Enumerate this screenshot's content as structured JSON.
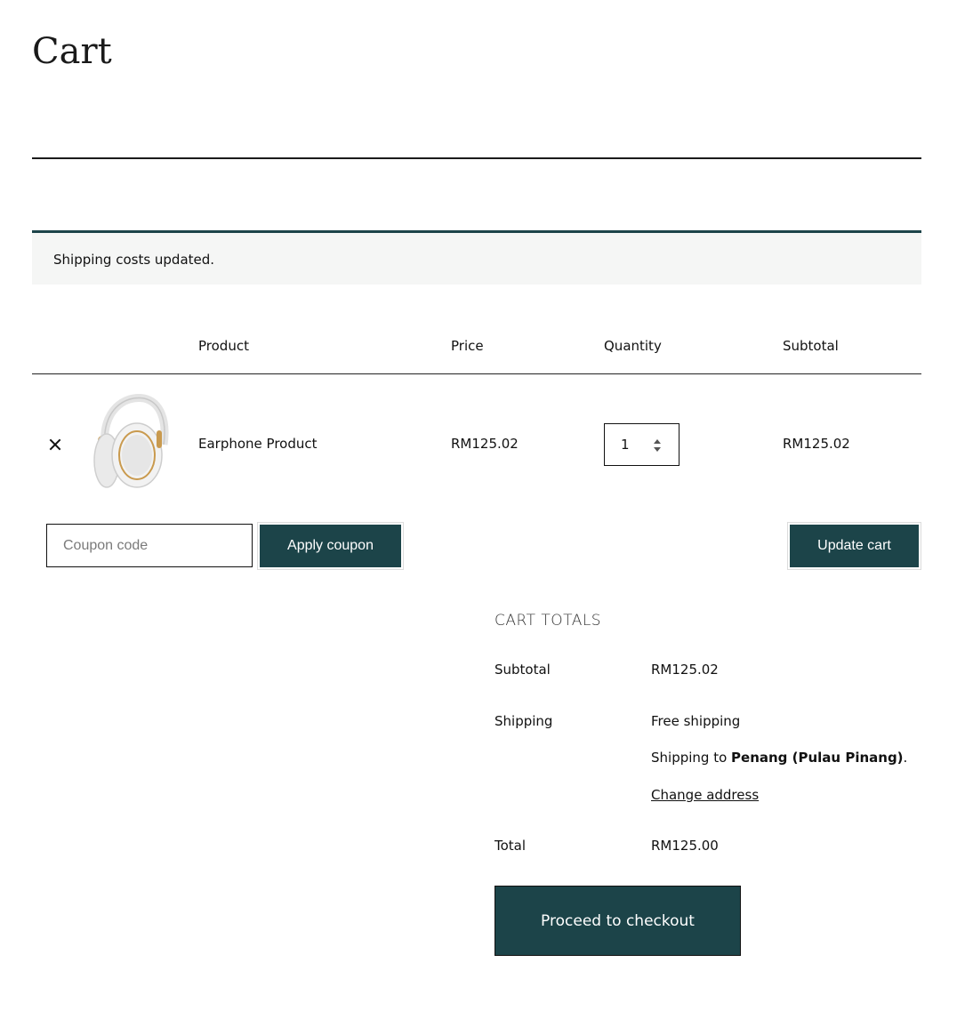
{
  "page": {
    "title": "Cart"
  },
  "notice": {
    "text": "Shipping costs updated."
  },
  "table": {
    "headers": {
      "product": "Product",
      "price": "Price",
      "quantity": "Quantity",
      "subtotal": "Subtotal"
    },
    "rows": [
      {
        "name": "Earphone Product",
        "price": "RM125.02",
        "quantity": "1",
        "subtotal": "RM125.02",
        "thumbnail_icon": "headphones-image"
      }
    ]
  },
  "coupon": {
    "placeholder": "Coupon code",
    "apply_label": "Apply coupon"
  },
  "update_label": "Update cart",
  "totals": {
    "heading": "CART TOTALS",
    "subtotal_label": "Subtotal",
    "subtotal_value": "RM125.02",
    "shipping_label": "Shipping",
    "shipping_method": "Free shipping",
    "shipping_to_prefix": "Shipping to ",
    "shipping_destination": "Penang (Pulau Pinang)",
    "shipping_to_suffix": ".",
    "change_address": "Change address",
    "total_label": "Total",
    "total_value": "RM125.00"
  },
  "checkout_label": "Proceed to checkout",
  "colors": {
    "accent": "#1c4449",
    "notice_bg": "#f5f6f5"
  }
}
